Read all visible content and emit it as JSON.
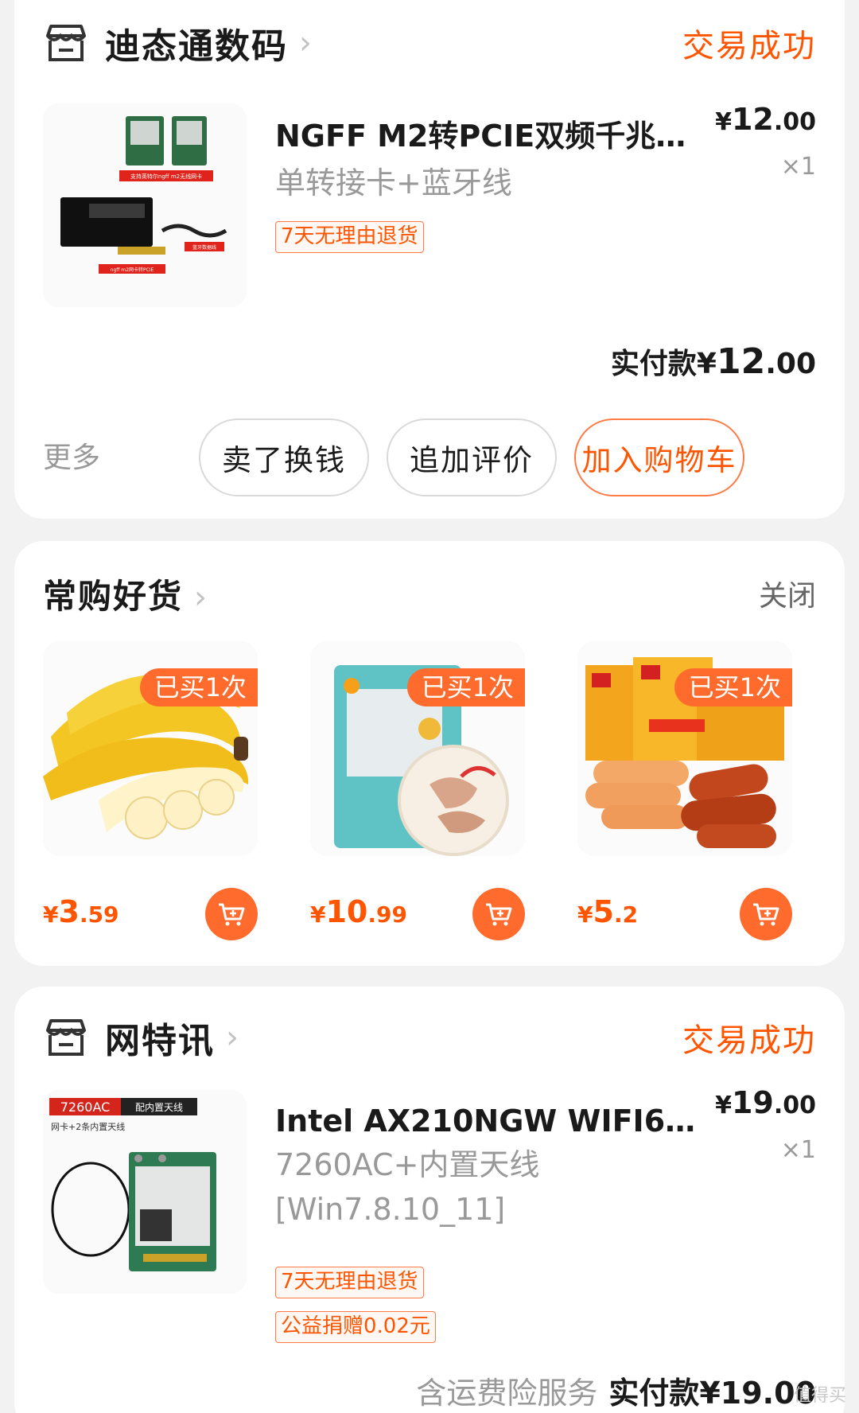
{
  "orders": [
    {
      "shop_name": "迪态通数码",
      "status": "交易成功",
      "product_title": "NGFF M2转PCIE双频千兆无…",
      "sku": "单转接卡+蓝牙线",
      "tags": [
        "7天无理由退货"
      ],
      "price_symbol": "¥",
      "price_int": "12",
      "price_dec": ".00",
      "qty": "×1",
      "paid_label": "实付款",
      "paid_symbol": "¥",
      "paid_int": "12",
      "paid_dec": ".00",
      "image_labels": [
        "支持英特尔ngff m2无线网卡",
        "蓝牙数据线",
        "ngff m2网卡转PCIE"
      ],
      "more_label": "更多",
      "buttons": [
        "卖了换钱",
        "追加评价",
        "加入购物车"
      ]
    },
    {
      "shop_name": "网特讯",
      "status": "交易成功",
      "product_title": "Intel AX210NGW WIFI6E千…",
      "sku_lines": [
        "7260AC+内置天线",
        "[Win7.8.10_11]"
      ],
      "tags": [
        "7天无理由退货",
        "公益捐赠0.02元"
      ],
      "price_symbol": "¥",
      "price_int": "19",
      "price_dec": ".00",
      "qty": "×1",
      "image_labels": [
        "7260AC",
        "配内置天线",
        "网卡+2条内置天线"
      ],
      "footer_service": "含运费险服务",
      "paid_label": "实付款",
      "paid_symbol": "¥",
      "paid_value": "19.00"
    }
  ],
  "frequent": {
    "title": "常购好货",
    "close_label": "关闭",
    "items": [
      {
        "badge": "已买1次",
        "symbol": "¥",
        "int": "3",
        "dec": ".59",
        "image": "banana"
      },
      {
        "badge": "已买1次",
        "symbol": "¥",
        "int": "10",
        "dec": ".99",
        "image": "chicken-wings"
      },
      {
        "badge": "已买1次",
        "symbol": "¥",
        "int": "5",
        "dec": ".2",
        "image": "sausages"
      }
    ]
  },
  "watermark": "值得买",
  "colors": {
    "accent": "#ff5500",
    "badge": "#ff6a2d",
    "muted": "#999999"
  }
}
